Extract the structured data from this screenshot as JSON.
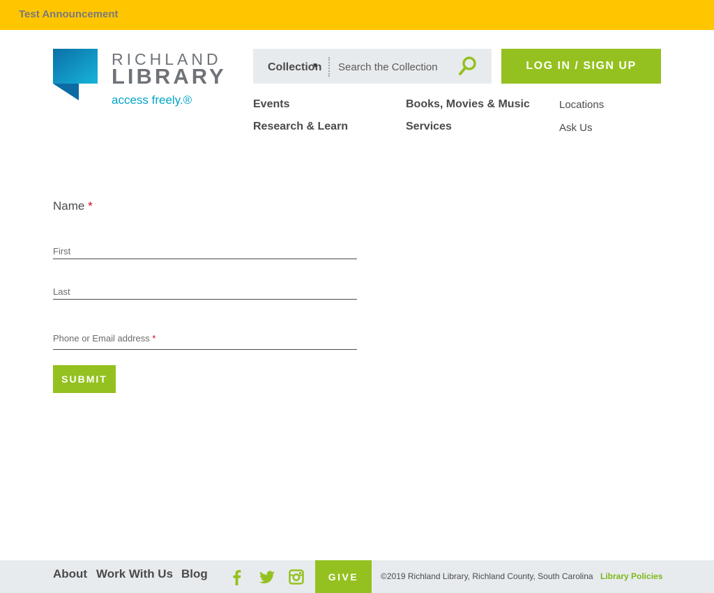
{
  "announcement": {
    "text": "Test Announcement"
  },
  "logo": {
    "line1": "RICHLAND",
    "line2": "LIBRARY",
    "tagline": "access freely.®",
    "icon": "richland-flag-logo"
  },
  "search": {
    "scope_label": "Collection",
    "placeholder": "Search the Collection",
    "icon": "magnifier-icon"
  },
  "login": {
    "label": "LOG IN / SIGN UP"
  },
  "nav": {
    "events": "Events",
    "research": "Research & Learn",
    "books": "Books, Movies & Music",
    "services": "Services",
    "locations": "Locations",
    "ask": "Ask Us"
  },
  "form": {
    "name_label": "Name",
    "required_mark": "*",
    "first_placeholder": "First",
    "last_placeholder": "Last",
    "contact_label": "Phone or Email address",
    "submit_label": "SUBMIT"
  },
  "footer": {
    "about": "About",
    "work": "Work With Us",
    "blog": "Blog",
    "social": [
      "facebook-icon",
      "twitter-icon",
      "instagram-icon"
    ],
    "give": "GIVE",
    "copyright": "©2019 Richland Library, Richland County, South Carolina",
    "policies": "Library Policies"
  },
  "colors": {
    "announcement_bg": "#ffc600",
    "accent_green": "#94c11f",
    "logo_blue": "#00a4c7",
    "footer_bg": "#e8ebee",
    "required_red": "#d0021b"
  }
}
